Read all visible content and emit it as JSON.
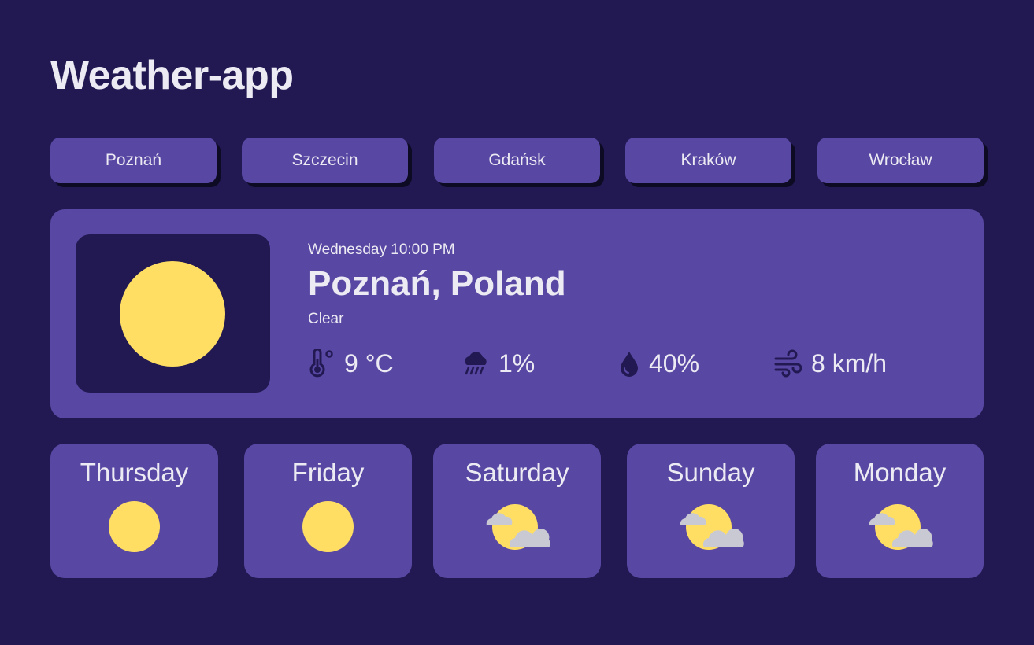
{
  "app": {
    "title": "Weather-app"
  },
  "cities": [
    "Poznań",
    "Szczecin",
    "Gdańsk",
    "Kraków",
    "Wrocław"
  ],
  "current": {
    "datetime": "Wednesday 10:00 PM",
    "location": "Poznań, Poland",
    "condition": "Clear",
    "icon": "sun-icon",
    "temperature": "9 °C",
    "precipitation": "1%",
    "humidity": "40%",
    "wind": "8 km/h"
  },
  "forecast": [
    {
      "day": "Thursday",
      "icon": "sun-icon"
    },
    {
      "day": "Friday",
      "icon": "sun-icon"
    },
    {
      "day": "Saturday",
      "icon": "partly-cloudy-icon"
    },
    {
      "day": "Sunday",
      "icon": "partly-cloudy-icon"
    },
    {
      "day": "Monday",
      "icon": "partly-cloudy-icon"
    }
  ],
  "colors": {
    "background": "#221953",
    "card": "#5948a3",
    "sun": "#ffde63",
    "text": "#ecebf3",
    "cloud": "#c9c9d3"
  }
}
